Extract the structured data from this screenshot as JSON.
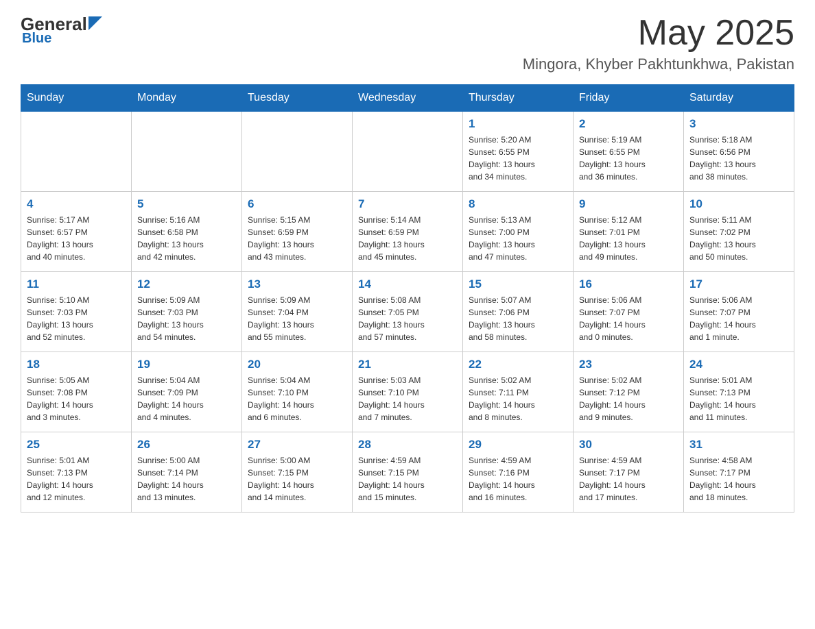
{
  "header": {
    "logo_general": "General",
    "logo_blue": "Blue",
    "month_title": "May 2025",
    "location": "Mingora, Khyber Pakhtunkhwa, Pakistan"
  },
  "days_of_week": [
    "Sunday",
    "Monday",
    "Tuesday",
    "Wednesday",
    "Thursday",
    "Friday",
    "Saturday"
  ],
  "weeks": [
    [
      {
        "day": "",
        "info": ""
      },
      {
        "day": "",
        "info": ""
      },
      {
        "day": "",
        "info": ""
      },
      {
        "day": "",
        "info": ""
      },
      {
        "day": "1",
        "info": "Sunrise: 5:20 AM\nSunset: 6:55 PM\nDaylight: 13 hours\nand 34 minutes."
      },
      {
        "day": "2",
        "info": "Sunrise: 5:19 AM\nSunset: 6:55 PM\nDaylight: 13 hours\nand 36 minutes."
      },
      {
        "day": "3",
        "info": "Sunrise: 5:18 AM\nSunset: 6:56 PM\nDaylight: 13 hours\nand 38 minutes."
      }
    ],
    [
      {
        "day": "4",
        "info": "Sunrise: 5:17 AM\nSunset: 6:57 PM\nDaylight: 13 hours\nand 40 minutes."
      },
      {
        "day": "5",
        "info": "Sunrise: 5:16 AM\nSunset: 6:58 PM\nDaylight: 13 hours\nand 42 minutes."
      },
      {
        "day": "6",
        "info": "Sunrise: 5:15 AM\nSunset: 6:59 PM\nDaylight: 13 hours\nand 43 minutes."
      },
      {
        "day": "7",
        "info": "Sunrise: 5:14 AM\nSunset: 6:59 PM\nDaylight: 13 hours\nand 45 minutes."
      },
      {
        "day": "8",
        "info": "Sunrise: 5:13 AM\nSunset: 7:00 PM\nDaylight: 13 hours\nand 47 minutes."
      },
      {
        "day": "9",
        "info": "Sunrise: 5:12 AM\nSunset: 7:01 PM\nDaylight: 13 hours\nand 49 minutes."
      },
      {
        "day": "10",
        "info": "Sunrise: 5:11 AM\nSunset: 7:02 PM\nDaylight: 13 hours\nand 50 minutes."
      }
    ],
    [
      {
        "day": "11",
        "info": "Sunrise: 5:10 AM\nSunset: 7:03 PM\nDaylight: 13 hours\nand 52 minutes."
      },
      {
        "day": "12",
        "info": "Sunrise: 5:09 AM\nSunset: 7:03 PM\nDaylight: 13 hours\nand 54 minutes."
      },
      {
        "day": "13",
        "info": "Sunrise: 5:09 AM\nSunset: 7:04 PM\nDaylight: 13 hours\nand 55 minutes."
      },
      {
        "day": "14",
        "info": "Sunrise: 5:08 AM\nSunset: 7:05 PM\nDaylight: 13 hours\nand 57 minutes."
      },
      {
        "day": "15",
        "info": "Sunrise: 5:07 AM\nSunset: 7:06 PM\nDaylight: 13 hours\nand 58 minutes."
      },
      {
        "day": "16",
        "info": "Sunrise: 5:06 AM\nSunset: 7:07 PM\nDaylight: 14 hours\nand 0 minutes."
      },
      {
        "day": "17",
        "info": "Sunrise: 5:06 AM\nSunset: 7:07 PM\nDaylight: 14 hours\nand 1 minute."
      }
    ],
    [
      {
        "day": "18",
        "info": "Sunrise: 5:05 AM\nSunset: 7:08 PM\nDaylight: 14 hours\nand 3 minutes."
      },
      {
        "day": "19",
        "info": "Sunrise: 5:04 AM\nSunset: 7:09 PM\nDaylight: 14 hours\nand 4 minutes."
      },
      {
        "day": "20",
        "info": "Sunrise: 5:04 AM\nSunset: 7:10 PM\nDaylight: 14 hours\nand 6 minutes."
      },
      {
        "day": "21",
        "info": "Sunrise: 5:03 AM\nSunset: 7:10 PM\nDaylight: 14 hours\nand 7 minutes."
      },
      {
        "day": "22",
        "info": "Sunrise: 5:02 AM\nSunset: 7:11 PM\nDaylight: 14 hours\nand 8 minutes."
      },
      {
        "day": "23",
        "info": "Sunrise: 5:02 AM\nSunset: 7:12 PM\nDaylight: 14 hours\nand 9 minutes."
      },
      {
        "day": "24",
        "info": "Sunrise: 5:01 AM\nSunset: 7:13 PM\nDaylight: 14 hours\nand 11 minutes."
      }
    ],
    [
      {
        "day": "25",
        "info": "Sunrise: 5:01 AM\nSunset: 7:13 PM\nDaylight: 14 hours\nand 12 minutes."
      },
      {
        "day": "26",
        "info": "Sunrise: 5:00 AM\nSunset: 7:14 PM\nDaylight: 14 hours\nand 13 minutes."
      },
      {
        "day": "27",
        "info": "Sunrise: 5:00 AM\nSunset: 7:15 PM\nDaylight: 14 hours\nand 14 minutes."
      },
      {
        "day": "28",
        "info": "Sunrise: 4:59 AM\nSunset: 7:15 PM\nDaylight: 14 hours\nand 15 minutes."
      },
      {
        "day": "29",
        "info": "Sunrise: 4:59 AM\nSunset: 7:16 PM\nDaylight: 14 hours\nand 16 minutes."
      },
      {
        "day": "30",
        "info": "Sunrise: 4:59 AM\nSunset: 7:17 PM\nDaylight: 14 hours\nand 17 minutes."
      },
      {
        "day": "31",
        "info": "Sunrise: 4:58 AM\nSunset: 7:17 PM\nDaylight: 14 hours\nand 18 minutes."
      }
    ]
  ]
}
